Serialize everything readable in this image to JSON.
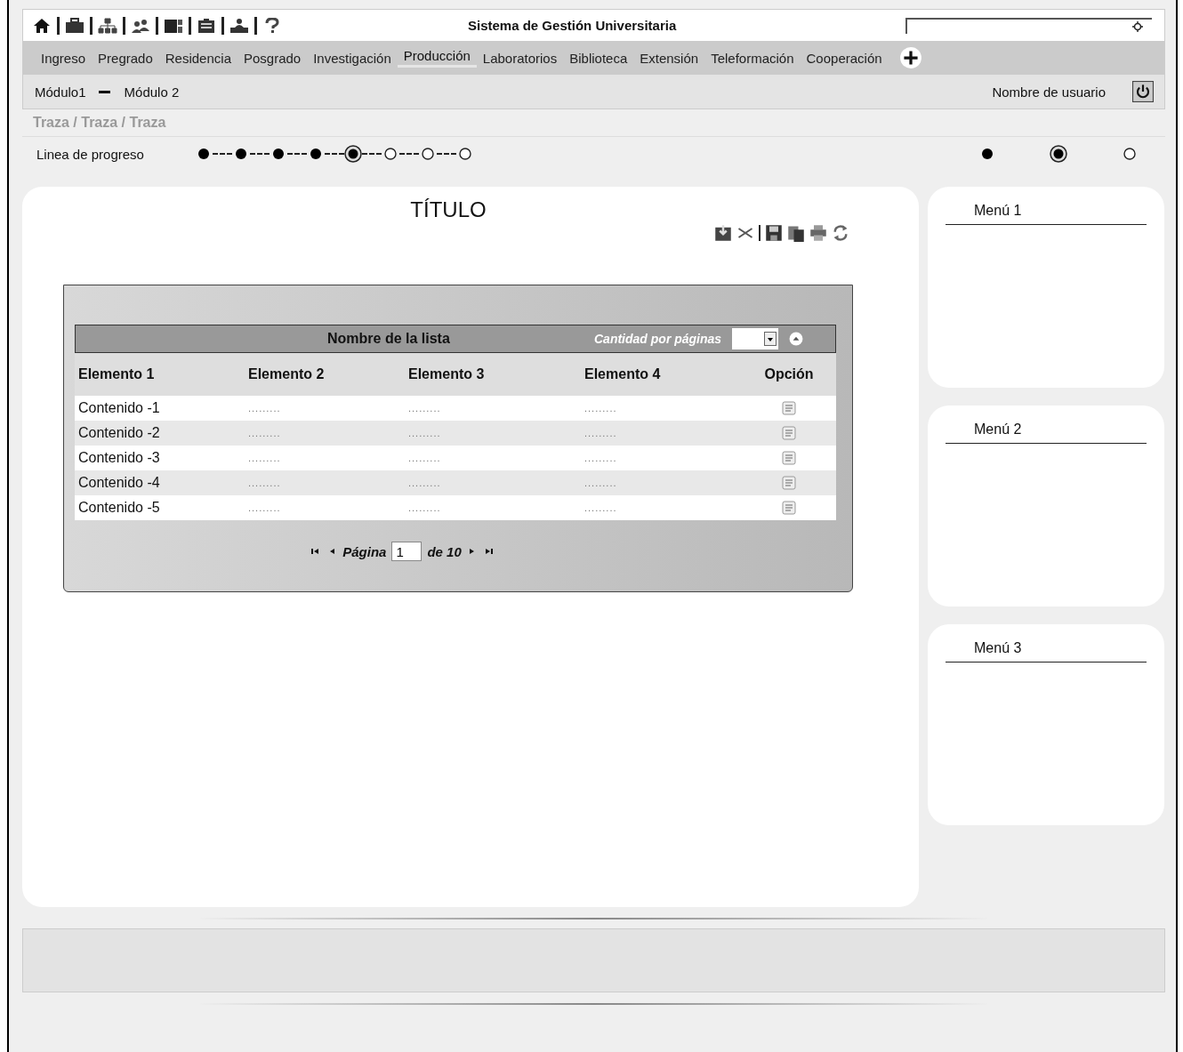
{
  "header": {
    "title": "Sistema de Gestión Universitaria"
  },
  "nav": [
    {
      "label": "Ingreso",
      "selected": false
    },
    {
      "label": "Pregrado",
      "selected": false
    },
    {
      "label": "Residencia",
      "selected": false
    },
    {
      "label": "Posgrado",
      "selected": false
    },
    {
      "label": "Investigación",
      "selected": false
    },
    {
      "label": "Producción",
      "selected": true
    },
    {
      "label": "Laboratorios",
      "selected": false
    },
    {
      "label": "Biblioteca",
      "selected": false
    },
    {
      "label": "Extensión",
      "selected": false
    },
    {
      "label": "Teleformación",
      "selected": false
    },
    {
      "label": "Cooperación",
      "selected": false
    }
  ],
  "module_bar": {
    "modules": [
      "Módulo1",
      "Módulo 2"
    ],
    "user": "Nombre de usuario"
  },
  "breadcrumb": "Traza / Traza / Traza",
  "progress": {
    "label": "Linea de progreso",
    "steps": [
      {
        "kind": "done"
      },
      {
        "kind": "done"
      },
      {
        "kind": "done"
      },
      {
        "kind": "done"
      },
      {
        "kind": "current"
      },
      {
        "kind": "pending"
      },
      {
        "kind": "pending"
      },
      {
        "kind": "pending"
      }
    ],
    "legend": [
      {
        "kind": "done"
      },
      {
        "kind": "current"
      },
      {
        "kind": "pending"
      }
    ]
  },
  "main": {
    "title": "TÍTULO",
    "list": {
      "name": "Nombre de la lista",
      "per_page_label": "Cantidad por páginas",
      "columns": [
        "Elemento 1",
        "Elemento 2",
        "Elemento 3",
        "Elemento 4",
        "Opción"
      ],
      "rows": [
        {
          "cells": [
            "Contenido -1",
            ".........",
            ".........",
            "........."
          ]
        },
        {
          "cells": [
            "Contenido -2",
            ".........",
            ".........",
            "........."
          ]
        },
        {
          "cells": [
            "Contenido -3",
            ".........",
            ".........",
            "........."
          ]
        },
        {
          "cells": [
            "Contenido -4",
            ".........",
            ".........",
            "........."
          ]
        },
        {
          "cells": [
            "Contenido -5",
            ".........",
            ".........",
            "........."
          ]
        }
      ],
      "pager": {
        "label": "Página",
        "page": "1",
        "total": "de 10"
      }
    }
  },
  "menus": [
    {
      "title": "Menú 1"
    },
    {
      "title": "Menú 2"
    },
    {
      "title": "Menú 3"
    }
  ]
}
